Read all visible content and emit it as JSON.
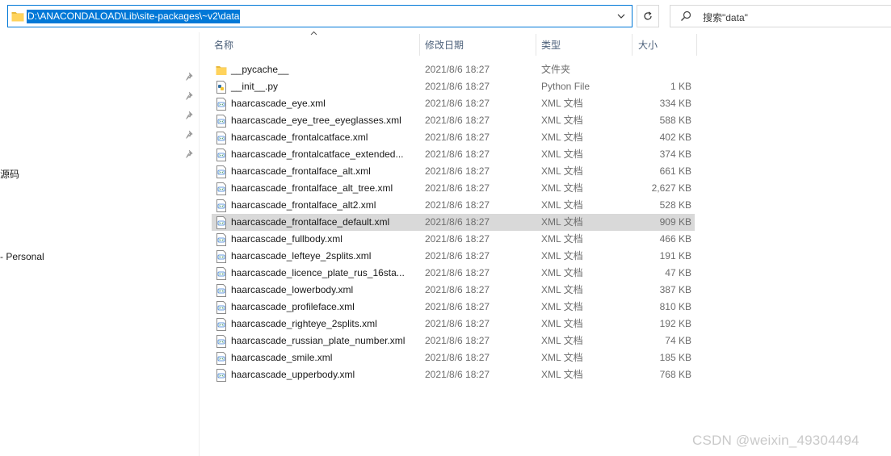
{
  "address_bar": {
    "path": "D:\\ANACONDALOAD\\Lib\\site-packages\\~v2\\data",
    "folder_icon": "folder-icon",
    "dropdown_icon": "chevron-down-icon"
  },
  "refresh": {
    "icon": "refresh-icon"
  },
  "search": {
    "placeholder": "搜索\"data\"",
    "icon": "search-icon"
  },
  "nav_pane": {
    "pin_icons": 5,
    "labels": [
      "源码",
      "- Personal"
    ]
  },
  "columns": {
    "name": "名称",
    "date": "修改日期",
    "type": "类型",
    "size": "大小",
    "sorted_by": "name"
  },
  "files": [
    {
      "name": "__pycache__",
      "date": "2021/8/6 18:27",
      "type": "文件夹",
      "size": "",
      "icon": "folder-icon"
    },
    {
      "name": "__init__.py",
      "date": "2021/8/6 18:27",
      "type": "Python File",
      "size": "1 KB",
      "icon": "python-file-icon"
    },
    {
      "name": "haarcascade_eye.xml",
      "date": "2021/8/6 18:27",
      "type": "XML 文档",
      "size": "334 KB",
      "icon": "xml-file-icon"
    },
    {
      "name": "haarcascade_eye_tree_eyeglasses.xml",
      "date": "2021/8/6 18:27",
      "type": "XML 文档",
      "size": "588 KB",
      "icon": "xml-file-icon"
    },
    {
      "name": "haarcascade_frontalcatface.xml",
      "date": "2021/8/6 18:27",
      "type": "XML 文档",
      "size": "402 KB",
      "icon": "xml-file-icon"
    },
    {
      "name": "haarcascade_frontalcatface_extended...",
      "date": "2021/8/6 18:27",
      "type": "XML 文档",
      "size": "374 KB",
      "icon": "xml-file-icon"
    },
    {
      "name": "haarcascade_frontalface_alt.xml",
      "date": "2021/8/6 18:27",
      "type": "XML 文档",
      "size": "661 KB",
      "icon": "xml-file-icon"
    },
    {
      "name": "haarcascade_frontalface_alt_tree.xml",
      "date": "2021/8/6 18:27",
      "type": "XML 文档",
      "size": "2,627 KB",
      "icon": "xml-file-icon"
    },
    {
      "name": "haarcascade_frontalface_alt2.xml",
      "date": "2021/8/6 18:27",
      "type": "XML 文档",
      "size": "528 KB",
      "icon": "xml-file-icon"
    },
    {
      "name": "haarcascade_frontalface_default.xml",
      "date": "2021/8/6 18:27",
      "type": "XML 文档",
      "size": "909 KB",
      "icon": "xml-file-icon",
      "selected": true
    },
    {
      "name": "haarcascade_fullbody.xml",
      "date": "2021/8/6 18:27",
      "type": "XML 文档",
      "size": "466 KB",
      "icon": "xml-file-icon"
    },
    {
      "name": "haarcascade_lefteye_2splits.xml",
      "date": "2021/8/6 18:27",
      "type": "XML 文档",
      "size": "191 KB",
      "icon": "xml-file-icon"
    },
    {
      "name": "haarcascade_licence_plate_rus_16sta...",
      "date": "2021/8/6 18:27",
      "type": "XML 文档",
      "size": "47 KB",
      "icon": "xml-file-icon"
    },
    {
      "name": "haarcascade_lowerbody.xml",
      "date": "2021/8/6 18:27",
      "type": "XML 文档",
      "size": "387 KB",
      "icon": "xml-file-icon"
    },
    {
      "name": "haarcascade_profileface.xml",
      "date": "2021/8/6 18:27",
      "type": "XML 文档",
      "size": "810 KB",
      "icon": "xml-file-icon"
    },
    {
      "name": "haarcascade_righteye_2splits.xml",
      "date": "2021/8/6 18:27",
      "type": "XML 文档",
      "size": "192 KB",
      "icon": "xml-file-icon"
    },
    {
      "name": "haarcascade_russian_plate_number.xml",
      "date": "2021/8/6 18:27",
      "type": "XML 文档",
      "size": "74 KB",
      "icon": "xml-file-icon"
    },
    {
      "name": "haarcascade_smile.xml",
      "date": "2021/8/6 18:27",
      "type": "XML 文档",
      "size": "185 KB",
      "icon": "xml-file-icon"
    },
    {
      "name": "haarcascade_upperbody.xml",
      "date": "2021/8/6 18:27",
      "type": "XML 文档",
      "size": "768 KB",
      "icon": "xml-file-icon"
    }
  ],
  "watermark": "CSDN @weixin_49304494",
  "colors": {
    "accent": "#0078d7",
    "selection": "#d9d9d9",
    "header_text": "#4c607a",
    "folder": "#ffd35c"
  }
}
